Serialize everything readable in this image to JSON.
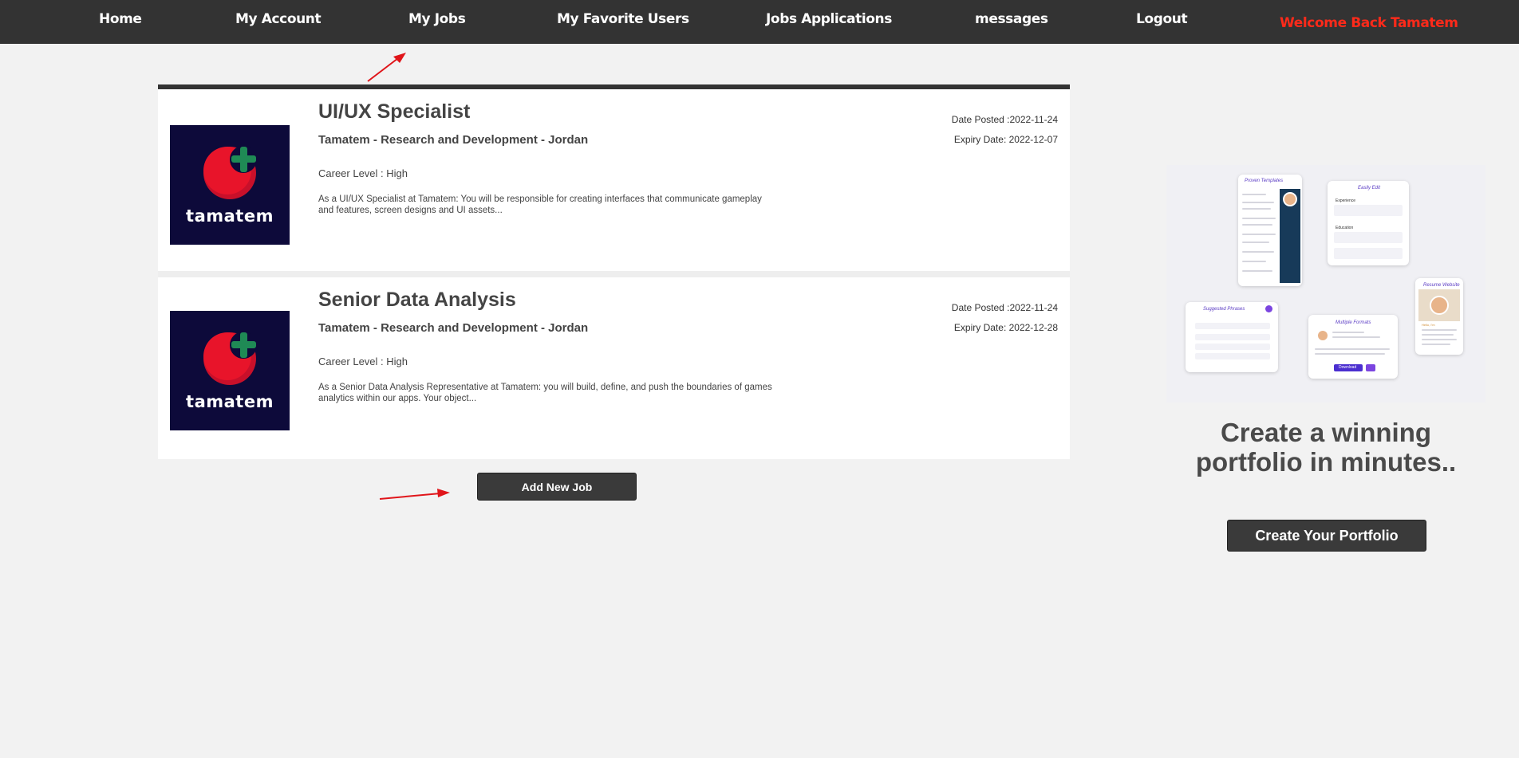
{
  "nav": {
    "items": [
      {
        "label": "Home"
      },
      {
        "label": "My Account"
      },
      {
        "label": "My Jobs"
      },
      {
        "label": "My Favorite Users"
      },
      {
        "label": "Jobs Applications"
      },
      {
        "label": "messages"
      },
      {
        "label": "Logout"
      }
    ],
    "welcome": "Welcome Back Tamatem"
  },
  "jobs": [
    {
      "title": "UI/UX Specialist",
      "company": "Tamatem - Research and Development - Jordan",
      "career_level": "Career Level : High",
      "description": "As a UI/UX Specialist at Tamatem: You will be responsible for creating interfaces that communicate gameplay and features, screen designs and UI assets...",
      "date_posted": "Date Posted :2022-11-24",
      "expiry_date": "Expiry Date: 2022-12-07",
      "logo_text": "tamatem"
    },
    {
      "title": "Senior Data Analysis",
      "company": "Tamatem - Research and Development - Jordan",
      "career_level": "Career Level : High",
      "description": "As a Senior Data Analysis Representative at Tamatem: you will build, define, and push the boundaries of games analytics within our apps. Your object...",
      "date_posted": "Date Posted :2022-11-24",
      "expiry_date": "Expiry Date: 2022-12-28",
      "logo_text": "tamatem"
    }
  ],
  "add_job_label": "Add New Job",
  "promo": {
    "title": "Create a winning portfolio in minutes..",
    "button_label": "Create Your Portfolio",
    "mock_labels": {
      "templates": "Proven Templates",
      "edit": "Easily Edit",
      "phrases": "Suggested Phrases",
      "formats": "Multiple Formats",
      "website": "Resume Website",
      "experience": "Experience",
      "education": "Education",
      "download": "Download",
      "hello": "Hello, I'm"
    }
  },
  "colors": {
    "nav_bg": "#333333",
    "welcome": "#ff2a1a",
    "button_bg": "#3a3a3a",
    "annotation_arrow": "#e0151a",
    "logo_bg": "#0d0a3a",
    "tomato": "#e8142a",
    "leaf": "#1f8a55"
  }
}
